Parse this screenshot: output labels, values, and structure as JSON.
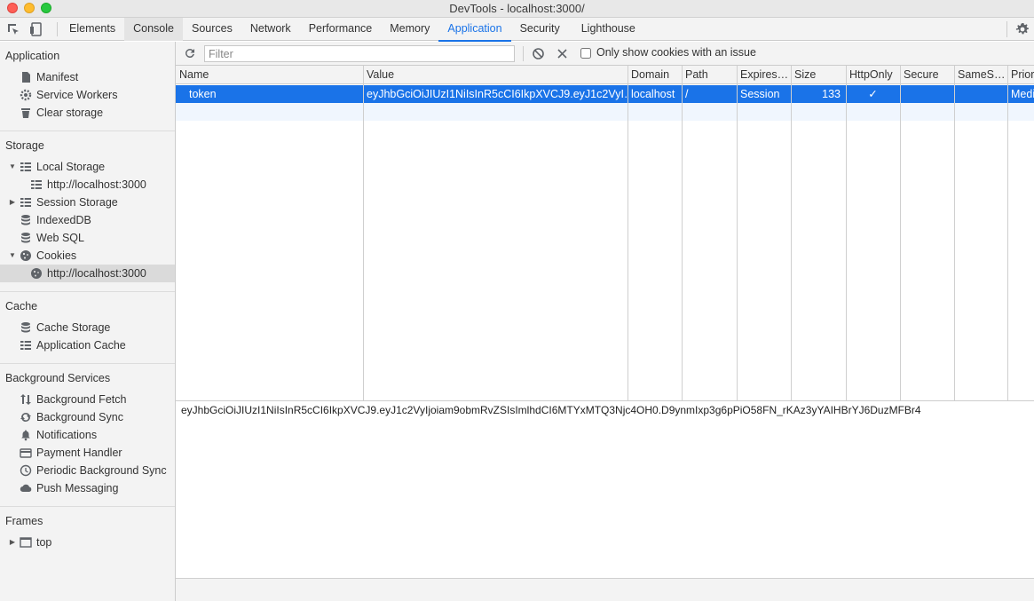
{
  "window": {
    "title": "DevTools - localhost:3000/"
  },
  "tabs": [
    "Elements",
    "Console",
    "Sources",
    "Network",
    "Performance",
    "Memory",
    "Application",
    "Security",
    "Lighthouse"
  ],
  "accent_color": "#1a73e8",
  "sidebar": {
    "application": {
      "heading": "Application",
      "items": [
        "Manifest",
        "Service Workers",
        "Clear storage"
      ]
    },
    "storage": {
      "heading": "Storage",
      "local_storage": "Local Storage",
      "local_storage_origin": "http://localhost:3000",
      "session_storage": "Session Storage",
      "indexeddb": "IndexedDB",
      "websql": "Web SQL",
      "cookies": "Cookies",
      "cookies_origin": "http://localhost:3000"
    },
    "cache": {
      "heading": "Cache",
      "items": [
        "Cache Storage",
        "Application Cache"
      ]
    },
    "background": {
      "heading": "Background Services",
      "items": [
        "Background Fetch",
        "Background Sync",
        "Notifications",
        "Payment Handler",
        "Periodic Background Sync",
        "Push Messaging"
      ]
    },
    "frames": {
      "heading": "Frames",
      "top": "top"
    }
  },
  "toolbar": {
    "filter_placeholder": "Filter",
    "only_issues_label": "Only show cookies with an issue"
  },
  "table": {
    "columns": [
      "Name",
      "Value",
      "Domain",
      "Path",
      "Expires…",
      "Size",
      "HttpOnly",
      "Secure",
      "SameS…",
      "Prior"
    ],
    "rows": [
      {
        "name": "token",
        "value": "eyJhbGciOiJIUzI1NiIsInR5cCI6IkpXVCJ9.eyJ1c2VyI…",
        "domain": "localhost",
        "path": "/",
        "expires": "Session",
        "size": "133",
        "httponly": "✓",
        "secure": "",
        "samesite": "",
        "priority": "Medi"
      }
    ]
  },
  "preview": {
    "value": "eyJhbGciOiJIUzI1NiIsInR5cCI6IkpXVCJ9.eyJ1c2VyIjoiam9obmRvZSIsImlhdCI6MTYxMTQ3Njc4OH0.D9ynmIxp3g6pPiO58FN_rKAz3yYAIHBrYJ6DuzMFBr4"
  }
}
